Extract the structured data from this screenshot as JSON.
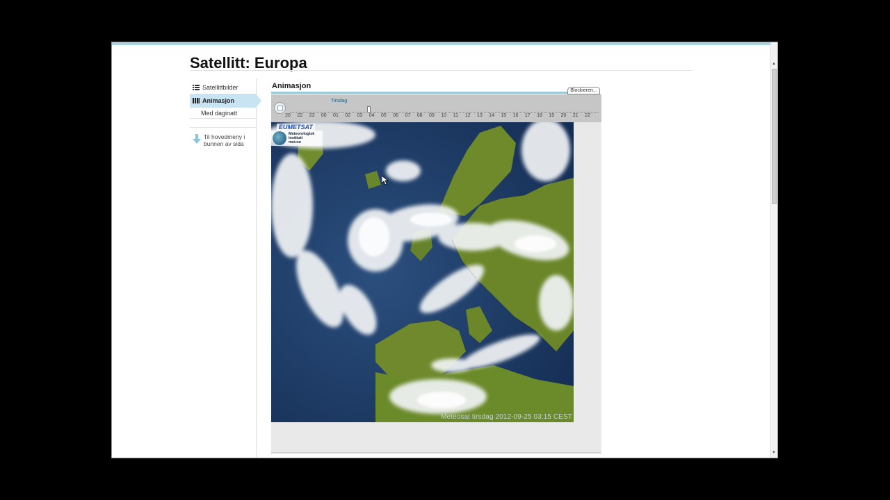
{
  "page": {
    "title": "Satellitt: Europa"
  },
  "sidebar": {
    "items": [
      {
        "label": "Satellittbilder",
        "icon": "list-icon"
      },
      {
        "label": "Animasjon",
        "icon": "film-icon",
        "active": true
      },
      {
        "label": "Med daginatt"
      }
    ],
    "back_link": {
      "line1": "Til hovedmeny i",
      "line2": "bunnen av sida",
      "icon": "arrow-down-icon"
    }
  },
  "section": {
    "title": "Animasjon",
    "block_button": "Blockieren..."
  },
  "timeline": {
    "day": "Tirsdag",
    "hours": [
      "20",
      "22",
      "23",
      "00",
      "01",
      "02",
      "03",
      "04",
      "05",
      "06",
      "07",
      "08",
      "09",
      "10",
      "11",
      "12",
      "13",
      "14",
      "15",
      "16",
      "17",
      "18",
      "19",
      "20",
      "21",
      "22"
    ],
    "position_fraction": 0.262
  },
  "image": {
    "brand": "EUMETSAT",
    "institute": [
      "Meteorologisk",
      "institutt",
      "met.no"
    ],
    "caption": "Meteosat tirsdag 2012-09-25 03:15 CEST"
  },
  "colors": {
    "accent": "#9ac8d8",
    "active_nav": "#c8e3f1",
    "sea": "#1b3a66",
    "land": "#6f8a2a"
  }
}
